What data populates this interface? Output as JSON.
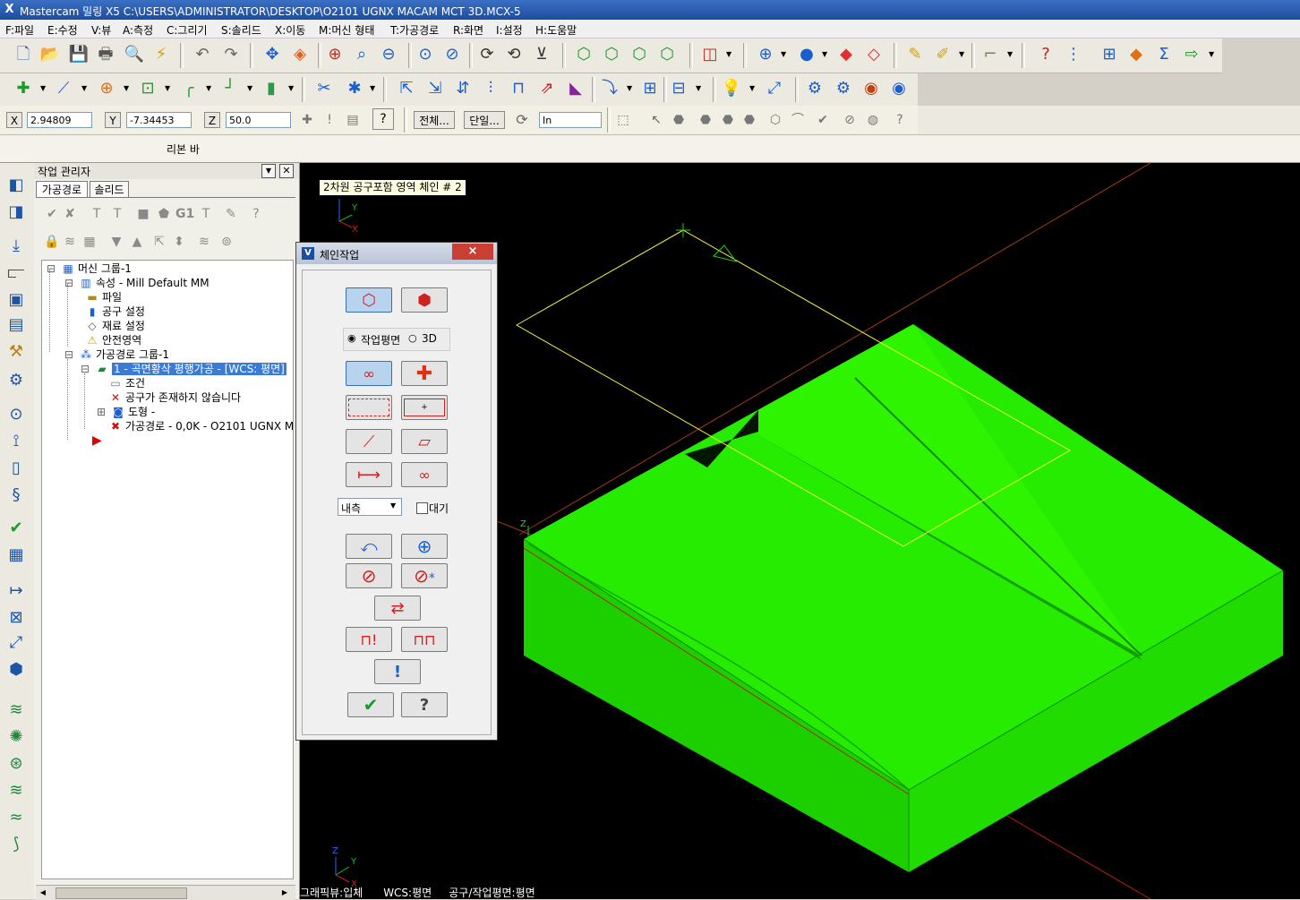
{
  "titlebar": {
    "app_icon": "X",
    "title": "Mastercam 밀링 X5  C:\\USERS\\ADMINISTRATOR\\DESKTOP\\O2101 UGNX MACAM MCT 3D.MCX-5"
  },
  "menu": [
    "F:파일",
    "E:수정",
    "V:뷰",
    "A:측정",
    "C:그리기",
    "S:솔리드",
    "X:이동",
    "M:머신 형태",
    "T:가공경로",
    "R:화면",
    "I:설정",
    "H:도움말"
  ],
  "coords": {
    "x_label": "X",
    "x_value": "2.94809",
    "y_label": "Y",
    "y_value": "-7.34453",
    "z_label": "Z",
    "z_value": "50.0",
    "all_button": "전체...",
    "single_button": "단일...",
    "unit_select": "In"
  },
  "ribbon_label": "리본 바",
  "ops_manager": {
    "title": "작업 관리자",
    "tabs": [
      "가공경로",
      "솔리드"
    ],
    "tree": [
      {
        "label": "머신 그룹-1",
        "icon": "machine-group-icon"
      },
      {
        "label": "속성 - Mill Default MM",
        "icon": "properties-icon"
      },
      {
        "label": "파일",
        "icon": "folder-icon"
      },
      {
        "label": "공구 설정",
        "icon": "tool-icon"
      },
      {
        "label": "재료 설정",
        "icon": "stock-icon"
      },
      {
        "label": "안전영역",
        "icon": "warning-icon"
      },
      {
        "label": "가공경로 그룹-1",
        "icon": "toolpath-group-icon"
      },
      {
        "label": "1 - 곡면황삭 평행가공 - [WCS: 평면]",
        "icon": "operation-folder-icon"
      },
      {
        "label": "조건",
        "icon": "parameters-icon"
      },
      {
        "label": "공구가 존재하지 않습니다",
        "icon": "error-x-icon"
      },
      {
        "label": "도형 -",
        "icon": "geometry-icon"
      },
      {
        "label": "가공경로 - 0,0K - O2101 UGNX M",
        "icon": "toolpath-dirty-icon"
      }
    ]
  },
  "tooltip": "2차원 공구포함 영역 체인 # 2",
  "chain_dialog": {
    "title": "체인작업",
    "close": "×",
    "radio_plane": "작업평면",
    "radio_3d": "3D",
    "inside_select": "내측",
    "wait_checkbox": "대기"
  },
  "axis_labels": {
    "x": "X",
    "y": "Y",
    "z": "Z"
  },
  "status": {
    "graphic_view": "그래픽뷰:입체",
    "wcs": "WCS:평면",
    "tool_plane": "공구/작업평면:평면"
  },
  "colors": {
    "solid": "#22e000",
    "graphics_bg": "#000000",
    "chain_outline": "#ffff40",
    "axis_red": "#b04010",
    "selection": "#3a7bd5"
  }
}
